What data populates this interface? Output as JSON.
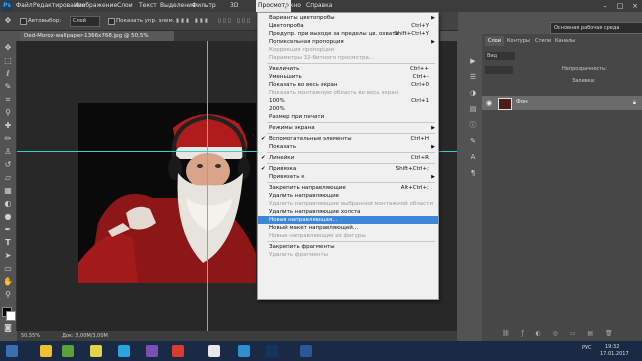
{
  "menubar": {
    "app_logo": "Ps",
    "items": [
      "Файл",
      "Редактирование",
      "Изображение",
      "Слои",
      "Текст",
      "Выделение",
      "Фильтр",
      "3D",
      "Просмотр",
      "Окно",
      "Справка"
    ],
    "open_item_index": 8,
    "window_controls": [
      "–",
      "□",
      "×"
    ]
  },
  "optbar": {
    "autoselect_label": "Автовыбор:",
    "autoselect_value": "Слой",
    "transform_label": "Показать упр. элем.",
    "essentials": "Основная рабочая среда"
  },
  "document": {
    "tab_title": "Ded-Moroz-wallpaper-1366x768.jpg @ 50,5% (RGB/8#)",
    "zoom": "50,55%",
    "doc_info": "Док: 3,00M/3,00M"
  },
  "view_menu": {
    "items": [
      {
        "label": "Варианты цветопробы",
        "shortcut": "",
        "arrow": true,
        "disabled": false,
        "check": false
      },
      {
        "label": "Цветопроба",
        "shortcut": "Ctrl+Y",
        "arrow": false,
        "disabled": false,
        "check": false
      },
      {
        "label": "Предупр. при выходе за пределы цв. охвата",
        "shortcut": "Shift+Ctrl+Y",
        "arrow": false,
        "disabled": false,
        "check": false
      },
      {
        "label": "Попиксельная пропорция",
        "shortcut": "",
        "arrow": true,
        "disabled": false,
        "check": false
      },
      {
        "label": "Коррекция пропорции",
        "shortcut": "",
        "arrow": false,
        "disabled": true,
        "check": false
      },
      {
        "label": "Параметры 32-битного просмотра...",
        "shortcut": "",
        "arrow": false,
        "disabled": true,
        "check": false
      },
      {
        "sep": true
      },
      {
        "label": "Увеличить",
        "shortcut": "Ctrl++",
        "arrow": false,
        "disabled": false,
        "check": false
      },
      {
        "label": "Уменьшить",
        "shortcut": "Ctrl+-",
        "arrow": false,
        "disabled": false,
        "check": false
      },
      {
        "label": "Показать во весь экран",
        "shortcut": "Ctrl+0",
        "arrow": false,
        "disabled": false,
        "check": false
      },
      {
        "label": "Показать монтажную область во весь экран",
        "shortcut": "",
        "arrow": false,
        "disabled": true,
        "check": false
      },
      {
        "label": "100%",
        "shortcut": "Ctrl+1",
        "arrow": false,
        "disabled": false,
        "check": false
      },
      {
        "label": "200%",
        "shortcut": "",
        "arrow": false,
        "disabled": false,
        "check": false
      },
      {
        "label": "Размер при печати",
        "shortcut": "",
        "arrow": false,
        "disabled": false,
        "check": false
      },
      {
        "sep": true
      },
      {
        "label": "Режимы экрана",
        "shortcut": "",
        "arrow": true,
        "disabled": false,
        "check": false
      },
      {
        "sep": true
      },
      {
        "label": "Вспомогательные элементы",
        "shortcut": "Ctrl+H",
        "arrow": false,
        "disabled": false,
        "check": true
      },
      {
        "label": "Показать",
        "shortcut": "",
        "arrow": true,
        "disabled": false,
        "check": false
      },
      {
        "sep": true
      },
      {
        "label": "Линейки",
        "shortcut": "Ctrl+R",
        "arrow": false,
        "disabled": false,
        "check": true
      },
      {
        "sep": true
      },
      {
        "label": "Привязка",
        "shortcut": "Shift+Ctrl+;",
        "arrow": false,
        "disabled": false,
        "check": true
      },
      {
        "label": "Привязать к",
        "shortcut": "",
        "arrow": true,
        "disabled": false,
        "check": false
      },
      {
        "sep": true
      },
      {
        "label": "Закрепить направляющие",
        "shortcut": "Alt+Ctrl+;",
        "arrow": false,
        "disabled": false,
        "check": false
      },
      {
        "label": "Удалить направляющие",
        "shortcut": "",
        "arrow": false,
        "disabled": false,
        "check": false
      },
      {
        "label": "Удалить направляющие выбранной монтажной области",
        "shortcut": "",
        "arrow": false,
        "disabled": true,
        "check": false
      },
      {
        "label": "Удалить направляющие холста",
        "shortcut": "",
        "arrow": false,
        "disabled": false,
        "check": false
      },
      {
        "label": "Новая направляющая...",
        "shortcut": "",
        "arrow": false,
        "disabled": false,
        "check": false,
        "highlight": true
      },
      {
        "label": "Новый макет направляющей...",
        "shortcut": "",
        "arrow": false,
        "disabled": false,
        "check": false
      },
      {
        "label": "Новые направляющие из фигуры",
        "shortcut": "",
        "arrow": false,
        "disabled": true,
        "check": false
      },
      {
        "sep": true
      },
      {
        "label": "Закрепить фрагменты",
        "shortcut": "",
        "arrow": false,
        "disabled": false,
        "check": false
      },
      {
        "label": "Удалить фрагменты",
        "shortcut": "",
        "arrow": false,
        "disabled": true,
        "check": false
      }
    ]
  },
  "layers_panel": {
    "tabs": [
      "Слои",
      "Контуры",
      "Стили",
      "Каналы"
    ],
    "kind_label": "Вид",
    "opacity_label": "Непрозрачность:",
    "fill_label": "Заливка:",
    "layer_name": "Фон"
  },
  "taskbar": {
    "time": "19:32",
    "date": "17.01.2017",
    "lang": "РУС"
  },
  "colors": {
    "accent_highlight": "#3d87d6",
    "guide": "#29d4d4",
    "menu_bg": "#f0f0f0"
  }
}
